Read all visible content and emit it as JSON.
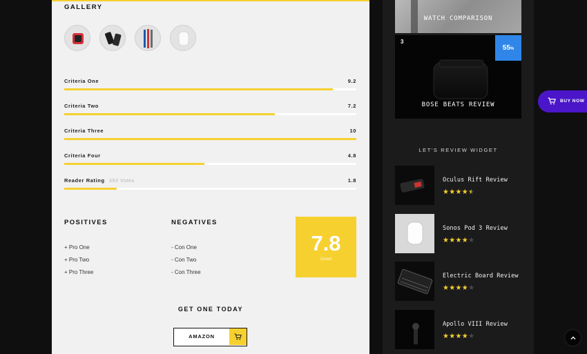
{
  "gallery": {
    "title": "GALLERY",
    "thumbnails": [
      "red-smartwatch",
      "black-phones",
      "watch-bands",
      "white-speaker"
    ]
  },
  "criteria": [
    {
      "name": "Criteria One",
      "score": "9.2",
      "fraction": 0.92
    },
    {
      "name": "Criteria Two",
      "score": "7.2",
      "fraction": 0.72
    },
    {
      "name": "Criteria Three",
      "score": "10",
      "fraction": 1.0
    },
    {
      "name": "Criteria Four",
      "score": "4.8",
      "fraction": 0.48
    },
    {
      "name": "Reader Rating",
      "votes": "393 Votes",
      "score": "1.8",
      "fraction": 0.18
    }
  ],
  "positives": {
    "title": "POSITIVES",
    "items": [
      "+ Pro One",
      "+ Pro Two",
      "+ Pro Three"
    ]
  },
  "negatives": {
    "title": "NEGATIVES",
    "items": [
      "- Con One",
      "- Con Two",
      "- Con Three"
    ]
  },
  "score": {
    "value": "7.8",
    "label": "Good"
  },
  "cta": {
    "title": "GET ONE TODAY",
    "button_label": "AMAZON",
    "icon": "cart-icon"
  },
  "sidebar": {
    "watch_card_title": "WATCH COMPARISON",
    "bose_card": {
      "number": "3",
      "badge_value": "55",
      "badge_unit": "%",
      "title": "BOSE BEATS REVIEW"
    },
    "widget_title": "LET'S REVIEW WIDGET",
    "reviews": [
      {
        "title": "Oculus Rift Review",
        "stars": 4.5
      },
      {
        "title": "Sonos Pod 3 Review",
        "stars": 4
      },
      {
        "title": "Electric Board Review",
        "stars": 4
      },
      {
        "title": "Apollo VIII Review",
        "stars": 4
      }
    ]
  },
  "buy_now": {
    "label": "BUY NOW",
    "icon": "cart-icon",
    "color": "#4b16c9"
  },
  "scroll_top": {
    "icon": "chevron-up-icon"
  },
  "colors": {
    "accent": "#f6d02f",
    "badge": "#2f86e8",
    "panel": "#f1f1f1",
    "sidebar": "#1b1b1c"
  }
}
